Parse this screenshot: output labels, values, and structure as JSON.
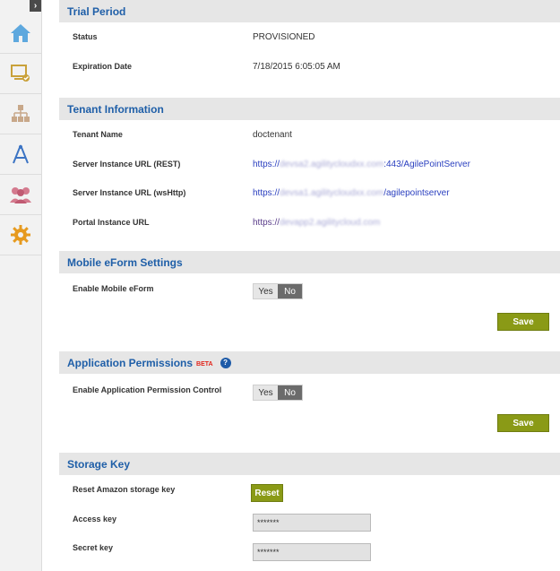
{
  "sidebar": {
    "toggle_glyph": "›",
    "items": [
      {
        "icon": "home-icon"
      },
      {
        "icon": "monitor-check-icon"
      },
      {
        "icon": "hierarchy-icon"
      },
      {
        "icon": "designer-compass-icon"
      },
      {
        "icon": "users-group-icon"
      },
      {
        "icon": "gear-icon"
      }
    ]
  },
  "trial": {
    "title": "Trial Period",
    "status_label": "Status",
    "status_value": "PROVISIONED",
    "expiration_label": "Expiration Date",
    "expiration_value": "7/18/2015 6:05:05 AM"
  },
  "tenant": {
    "title": "Tenant Information",
    "name_label": "Tenant Name",
    "name_value": "doctenant",
    "rest_label": "Server Instance URL (REST)",
    "rest_prefix": "https://",
    "rest_masked": "devsa2.agilitycloudxx.com",
    "rest_suffix": ":443/AgilePointServer",
    "wshttp_label": "Server Instance URL (wsHttp)",
    "wshttp_prefix": "https://",
    "wshttp_masked": "devsa1.agilitycloudxx.com",
    "wshttp_suffix": "/agilepointserver",
    "portal_label": "Portal Instance URL",
    "portal_prefix": "https://",
    "portal_masked": "devapp2.agilitycloud.com"
  },
  "mobile": {
    "title": "Mobile eForm Settings",
    "enable_label": "Enable Mobile eForm",
    "yes": "Yes",
    "no": "No",
    "save": "Save"
  },
  "permissions": {
    "title": "Application Permissions",
    "beta": "BETA",
    "help": "?",
    "enable_label": "Enable Application Permission Control",
    "yes": "Yes",
    "no": "No",
    "save": "Save"
  },
  "storage": {
    "title": "Storage Key",
    "reset_label": "Reset Amazon storage key",
    "reset_button": "Reset",
    "access_label": "Access key",
    "access_value": "*******",
    "secret_label": "Secret key",
    "secret_value": "*******"
  },
  "colors": {
    "header_text": "#1f5fa8",
    "header_bg": "#e6e6e6",
    "button": "#8a9a16",
    "toggle_selected": "#6b6b6b"
  }
}
